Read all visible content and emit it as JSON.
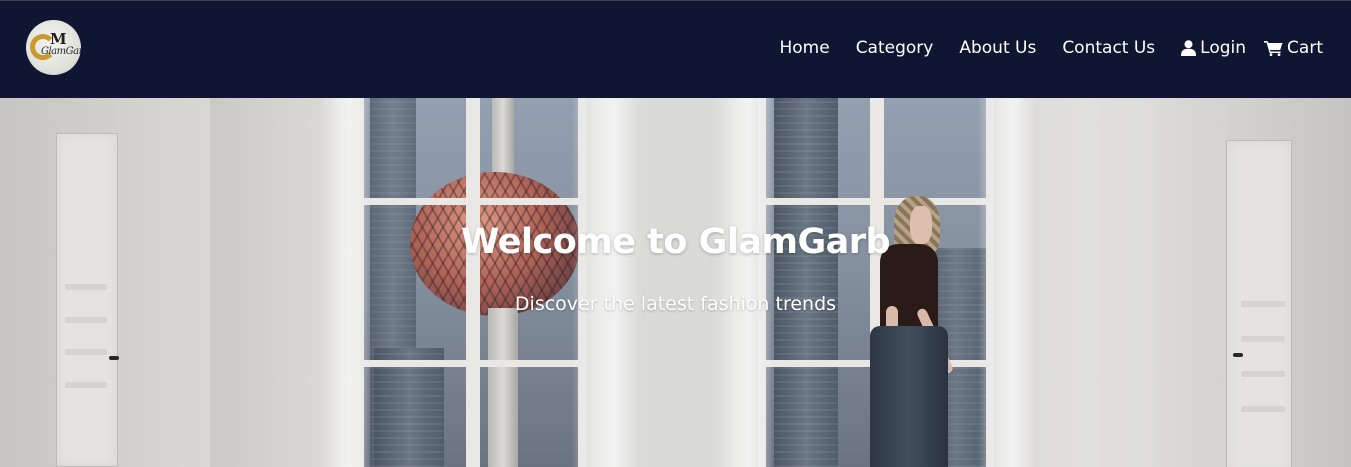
{
  "header": {
    "logo_text": "GM GlamGarb",
    "nav": [
      {
        "label": "Home"
      },
      {
        "label": "Category"
      },
      {
        "label": "About Us"
      },
      {
        "label": "Contact Us"
      },
      {
        "label": "Login",
        "icon": "user-icon"
      },
      {
        "label": "Cart",
        "icon": "cart-icon"
      }
    ],
    "colors": {
      "background": "#0f1631",
      "text": "#ffffff"
    }
  },
  "hero": {
    "title": "Welcome to GlamGarb",
    "subtitle": "Discover the latest fashion trends"
  }
}
